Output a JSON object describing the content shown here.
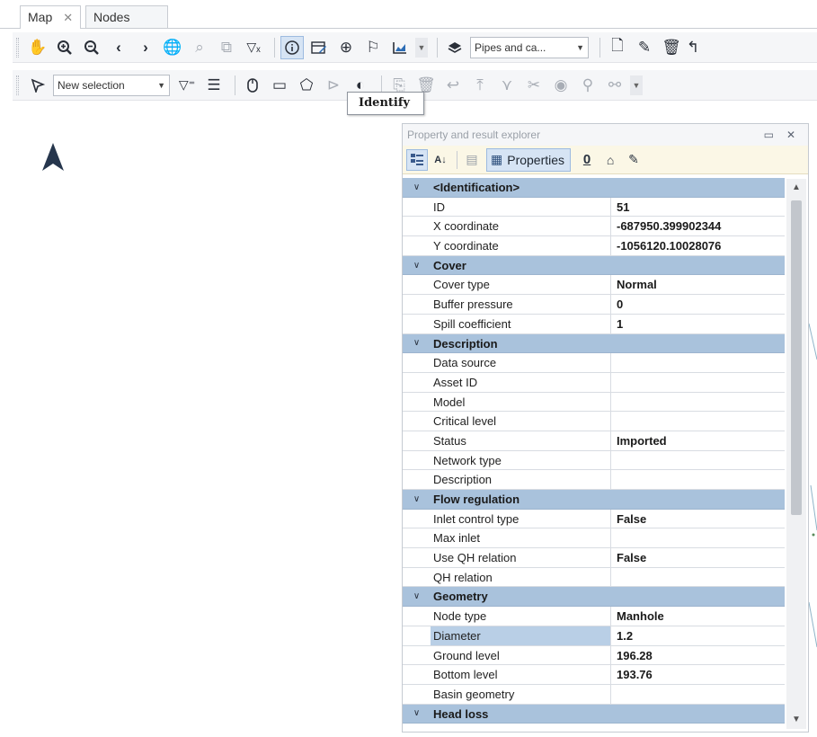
{
  "tabs": [
    {
      "label": "Map",
      "close_icon": "close-icon"
    },
    {
      "label": "Nodes"
    }
  ],
  "toolbar1": {
    "buttons": [
      "pan-hand-icon",
      "zoom-in-icon",
      "zoom-out-icon",
      "back-icon",
      "forward-icon",
      "globe-icon",
      "zoom-selection-icon",
      "zoom-layer-icon",
      "clear-filter-icon",
      "identify-icon",
      "edit-properties-icon",
      "crosshair-icon",
      "flag-icon",
      "chart-icon"
    ],
    "layer_combo": "Pipes and ca..."
  },
  "toolbar2": {
    "selection_combo": "New selection"
  },
  "tooltip": "Identify",
  "panel": {
    "title": "Property and result explorer",
    "properties_label": "Properties",
    "zero_label": "0"
  },
  "grid": [
    {
      "type": "cat",
      "name": "<Identification>"
    },
    {
      "type": "row",
      "name": "ID",
      "value": "51"
    },
    {
      "type": "row",
      "name": "X coordinate",
      "value": "-687950.399902344"
    },
    {
      "type": "row",
      "name": "Y coordinate",
      "value": "-1056120.10028076"
    },
    {
      "type": "cat",
      "name": "Cover"
    },
    {
      "type": "row",
      "name": "Cover type",
      "value": "Normal"
    },
    {
      "type": "row",
      "name": "Buffer pressure",
      "value": "0"
    },
    {
      "type": "row",
      "name": "Spill coefficient",
      "value": "1"
    },
    {
      "type": "cat",
      "name": "Description"
    },
    {
      "type": "row",
      "name": "Data source",
      "value": ""
    },
    {
      "type": "row",
      "name": "Asset ID",
      "value": ""
    },
    {
      "type": "row",
      "name": "Model",
      "value": ""
    },
    {
      "type": "row",
      "name": "Critical level",
      "value": ""
    },
    {
      "type": "row",
      "name": "Status",
      "value": "Imported"
    },
    {
      "type": "row",
      "name": "Network type",
      "value": ""
    },
    {
      "type": "row",
      "name": "Description",
      "value": ""
    },
    {
      "type": "cat",
      "name": "Flow regulation"
    },
    {
      "type": "row",
      "name": "Inlet control type",
      "value": "False"
    },
    {
      "type": "row",
      "name": "Max inlet",
      "value": ""
    },
    {
      "type": "row",
      "name": "Use QH relation",
      "value": "False"
    },
    {
      "type": "row",
      "name": "QH relation",
      "value": ""
    },
    {
      "type": "cat",
      "name": "Geometry"
    },
    {
      "type": "row",
      "name": "Node type",
      "value": "Manhole"
    },
    {
      "type": "row",
      "name": "Diameter",
      "value": "1.2",
      "selected": true
    },
    {
      "type": "row",
      "name": "Ground level",
      "value": "196.28"
    },
    {
      "type": "row",
      "name": "Bottom level",
      "value": "193.76"
    },
    {
      "type": "row",
      "name": "Basin geometry",
      "value": ""
    },
    {
      "type": "cat",
      "name": "Head loss"
    }
  ]
}
